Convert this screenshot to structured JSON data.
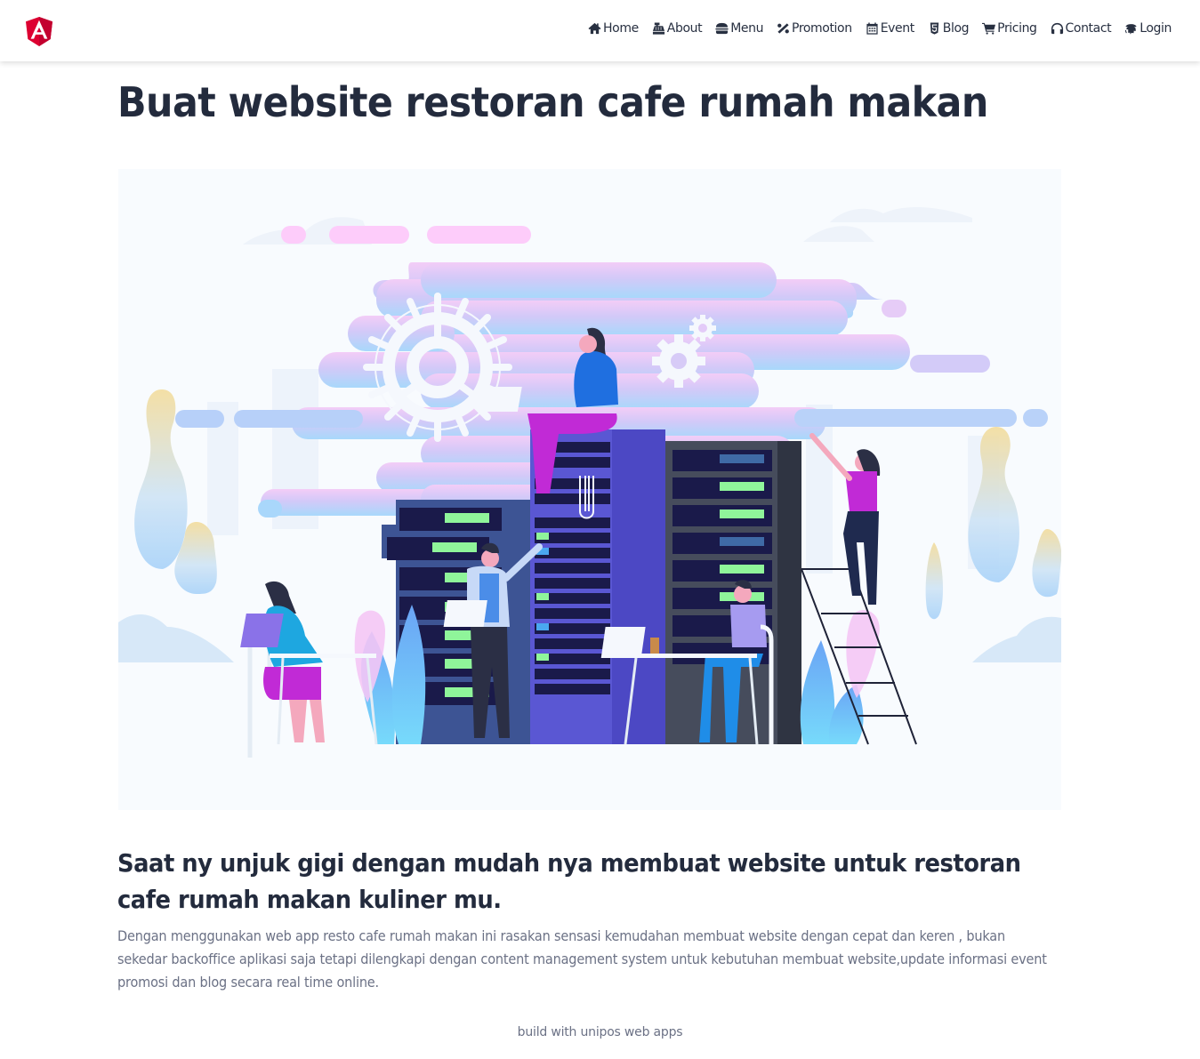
{
  "navbar": {
    "logo": "angular-logo",
    "items": [
      {
        "label": "Home",
        "icon": "home-icon"
      },
      {
        "label": "About",
        "icon": "cash-register-icon"
      },
      {
        "label": "Menu",
        "icon": "hamburger-icon"
      },
      {
        "label": "Promotion",
        "icon": "percent-icon"
      },
      {
        "label": "Event",
        "icon": "calendar-icon"
      },
      {
        "label": "Blog",
        "icon": "html5-icon"
      },
      {
        "label": "Pricing",
        "icon": "shopping-cart-icon"
      },
      {
        "label": "Contact",
        "icon": "headphones-icon"
      },
      {
        "label": "Login",
        "icon": "fingerprint-icon"
      }
    ]
  },
  "main": {
    "title": "Buat website restoran cafe rumah makan",
    "hero_image": "server-room-team-illustration",
    "subtitle": "Saat ny unjuk gigi dengan mudah nya membuat website untuk restoran cafe rumah makan kuliner mu.",
    "description": "Dengan menggunakan web app resto cafe rumah makan ini rasakan sensasi kemudahan membuat website dengan cepat dan keren , bukan sekedar backoffice aplikasi saja tetapi dilengkapi dengan content management system untuk kebutuhan membuat website,update informasi event promosi dan blog secara real time online."
  },
  "footer": {
    "text": "build with unipos web apps"
  },
  "colors": {
    "brand_red": "#dd0031",
    "text_dark": "#232b3d",
    "text_muted": "#6b7185"
  }
}
